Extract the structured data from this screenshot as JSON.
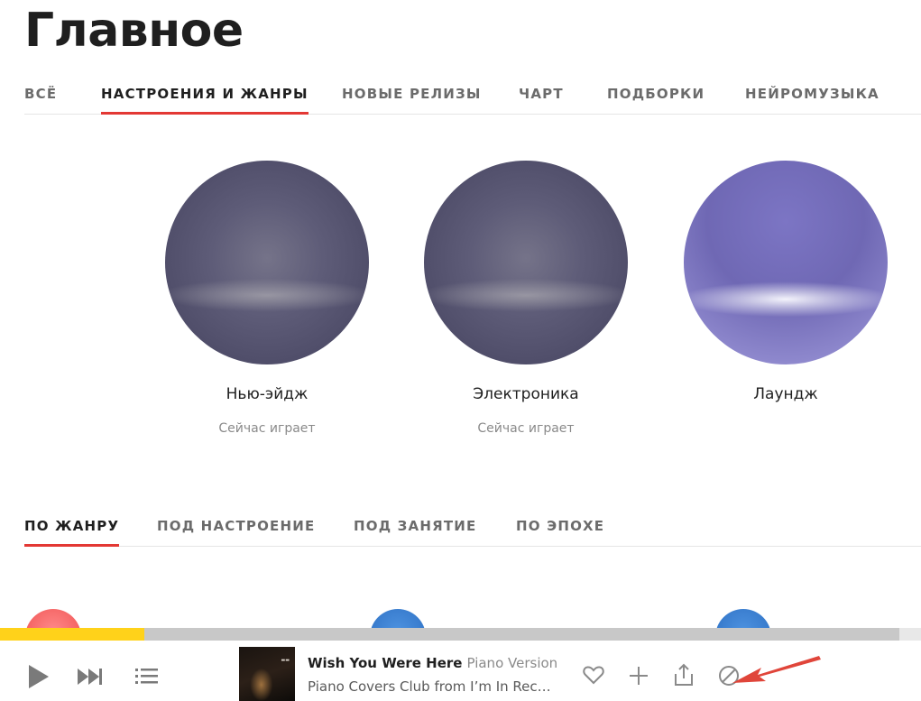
{
  "page": {
    "title": "Главное"
  },
  "tabs": [
    {
      "label": "ВСЁ"
    },
    {
      "label": "НАСТРОЕНИЯ И ЖАНРЫ",
      "active": true
    },
    {
      "label": "НОВЫЕ РЕЛИЗЫ"
    },
    {
      "label": "ЧАРТ"
    },
    {
      "label": "ПОДБОРКИ"
    },
    {
      "label": "НЕЙРОМУЗЫКА"
    }
  ],
  "stations": [
    {
      "name": "Нью-эйдж",
      "status": "Сейчас играет"
    },
    {
      "name": "Электроника",
      "status": "Сейчас играет"
    },
    {
      "name": "Лаундж"
    }
  ],
  "subtabs": [
    {
      "label": "ПО ЖАНРУ",
      "active": true
    },
    {
      "label": "ПОД НАСТРОЕНИЕ"
    },
    {
      "label": "ПОД ЗАНЯТИЕ"
    },
    {
      "label": "ПО ЭПОХЕ"
    }
  ],
  "player": {
    "progress": 0.16,
    "track_title": "Wish You Were Here",
    "track_version": "Piano Version",
    "track_artist": "Piano Covers Club from I’m In Recor…",
    "icons": [
      "play-icon",
      "next-icon",
      "queue-icon",
      "like-icon",
      "add-icon",
      "share-icon",
      "dislike-icon"
    ]
  },
  "colors": {
    "accent_red": "#e33834",
    "progress_yellow": "#ffd21a",
    "annotation_arrow": "#e0453a"
  }
}
